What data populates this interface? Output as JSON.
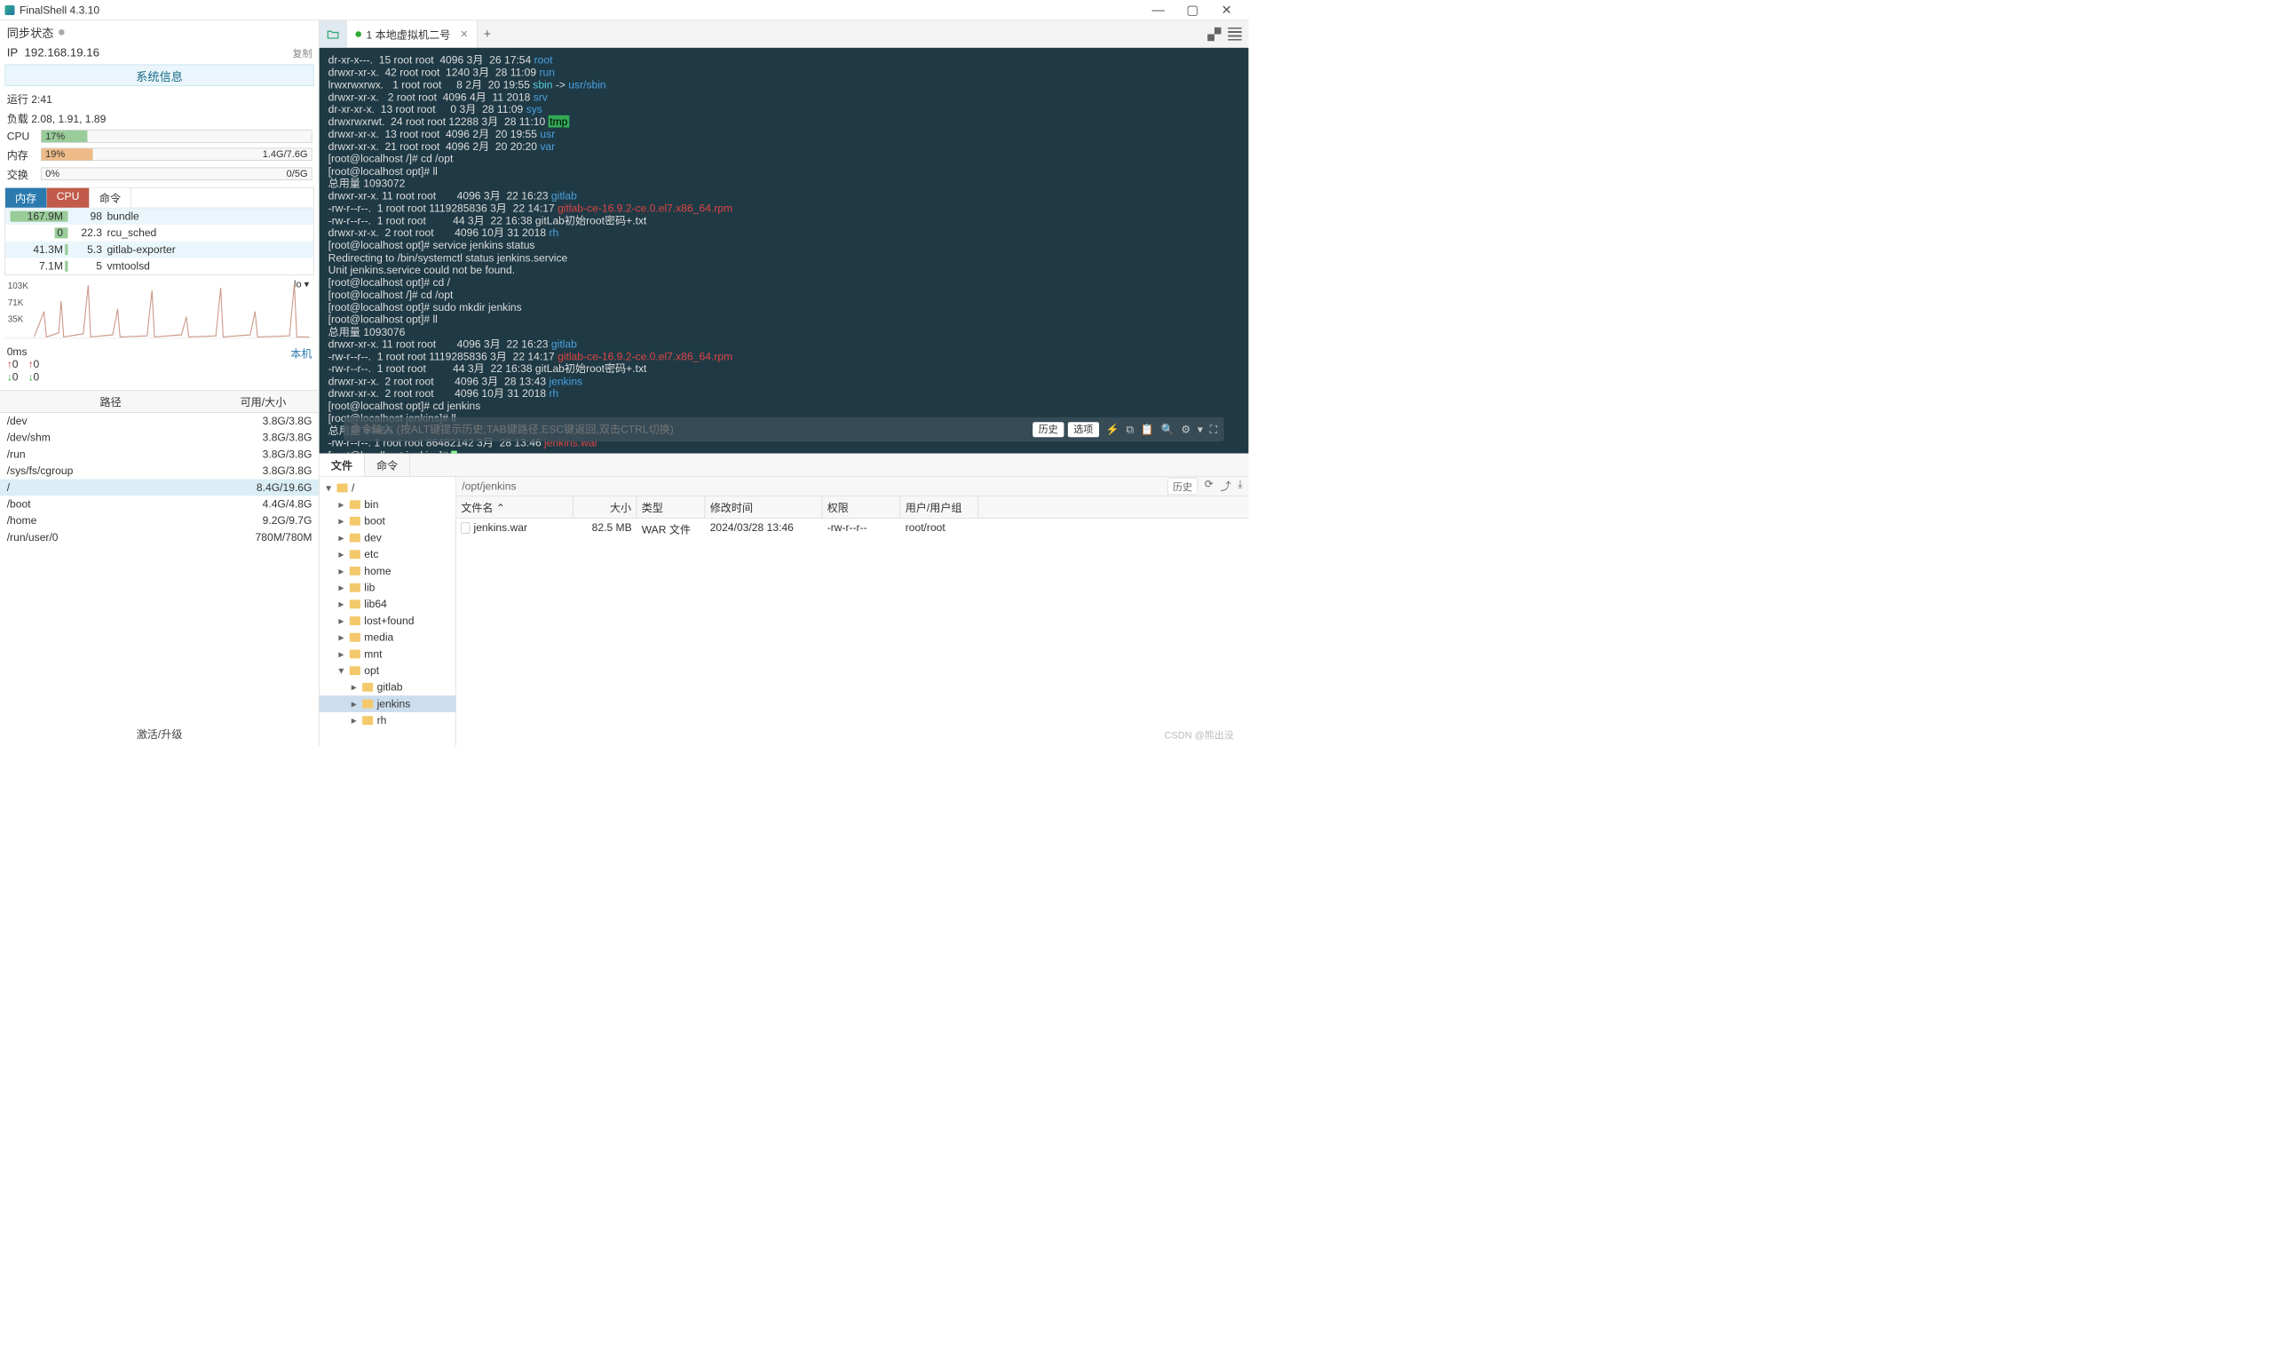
{
  "app": {
    "title": "FinalShell 4.3.10"
  },
  "window_buttons": {
    "min": "—",
    "max": "▢",
    "close": "✕"
  },
  "left": {
    "sync_label": "同步状态",
    "ip_label": "IP",
    "ip_value": "192.168.19.16",
    "copy_label": "复制",
    "sysinfo_btn": "系统信息",
    "uptime": "运行 2:41",
    "load": "负载 2.08, 1.91, 1.89",
    "cpu_label": "CPU",
    "cpu_pct": "17%",
    "mem_label": "内存",
    "mem_pct": "19%",
    "mem_text": "1.4G/7.6G",
    "swap_label": "交换",
    "swap_pct": "0%",
    "swap_text": "0/5G",
    "tabs": {
      "mem": "内存",
      "cpu": "CPU",
      "cmd": "命令"
    },
    "procs": [
      {
        "mem": "167.9M",
        "cpu": "98",
        "name": "bundle"
      },
      {
        "mem": "0",
        "cpu": "22.3",
        "name": "rcu_sched"
      },
      {
        "mem": "41.3M",
        "cpu": "5.3",
        "name": "gitlab-exporter"
      },
      {
        "mem": "7.1M",
        "cpu": "5",
        "name": "vmtoolsd"
      }
    ],
    "spark_y": [
      "103K",
      "71K",
      "35K"
    ],
    "spark_lo": "lo  ▾",
    "net": {
      "ms": "0ms",
      "local": "本机",
      "up1": "0",
      "dn1": "0",
      "up2": "0",
      "dn2": "0"
    },
    "fs_head": {
      "path": "路径",
      "size": "可用/大小"
    },
    "fs": [
      {
        "p": "/dev",
        "s": "3.8G/3.8G"
      },
      {
        "p": "/dev/shm",
        "s": "3.8G/3.8G"
      },
      {
        "p": "/run",
        "s": "3.8G/3.8G"
      },
      {
        "p": "/sys/fs/cgroup",
        "s": "3.8G/3.8G"
      },
      {
        "p": "/",
        "s": "8.4G/19.6G",
        "hl": true
      },
      {
        "p": "/boot",
        "s": "4.4G/4.8G"
      },
      {
        "p": "/home",
        "s": "9.2G/9.7G"
      },
      {
        "p": "/run/user/0",
        "s": "780M/780M"
      }
    ],
    "activate": "激活/升级"
  },
  "tabs_top": {
    "name": "1 本地虚拟机二号"
  },
  "terminal_lines": [
    {
      "segs": [
        {
          "t": "dr-xr-x---.  15 root root  4096 3月  26 17:54 "
        },
        {
          "t": "root",
          "c": "c-blue"
        }
      ]
    },
    {
      "segs": [
        {
          "t": "drwxr-xr-x.  42 root root  1240 3月  28 11:09 "
        },
        {
          "t": "run",
          "c": "c-blue"
        }
      ]
    },
    {
      "segs": [
        {
          "t": "lrwxrwxrwx.   1 root root     8 2月  20 19:55 "
        },
        {
          "t": "sbin",
          "c": "c-cyan"
        },
        {
          "t": " -> "
        },
        {
          "t": "usr/sbin",
          "c": "c-blue"
        }
      ]
    },
    {
      "segs": [
        {
          "t": "drwxr-xr-x.   2 root root  4096 4月  11 2018 "
        },
        {
          "t": "srv",
          "c": "c-blue"
        }
      ]
    },
    {
      "segs": [
        {
          "t": "dr-xr-xr-x.  13 root root     0 3月  28 11:09 "
        },
        {
          "t": "sys",
          "c": "c-blue"
        }
      ]
    },
    {
      "segs": [
        {
          "t": "drwxrwxrwt.  24 root root 12288 3月  28 11:10 "
        },
        {
          "t": "tmp",
          "c": "c-green"
        }
      ]
    },
    {
      "segs": [
        {
          "t": "drwxr-xr-x.  13 root root  4096 2月  20 19:55 "
        },
        {
          "t": "usr",
          "c": "c-blue"
        }
      ]
    },
    {
      "segs": [
        {
          "t": "drwxr-xr-x.  21 root root  4096 2月  20 20:20 "
        },
        {
          "t": "var",
          "c": "c-blue"
        }
      ]
    },
    {
      "segs": [
        {
          "t": "[root@localhost /]# cd /opt"
        }
      ]
    },
    {
      "segs": [
        {
          "t": "[root@localhost opt]# ll"
        }
      ]
    },
    {
      "segs": [
        {
          "t": "总用量 1093072"
        }
      ]
    },
    {
      "segs": [
        {
          "t": "drwxr-xr-x. 11 root root       4096 3月  22 16:23 "
        },
        {
          "t": "gitlab",
          "c": "c-blue"
        }
      ]
    },
    {
      "segs": [
        {
          "t": "-rw-r--r--.  1 root root 1119285836 3月  22 14:17 "
        },
        {
          "t": "gitlab-ce-16.9.2-ce.0.el7.x86_64.rpm",
          "c": "c-red"
        }
      ]
    },
    {
      "segs": [
        {
          "t": "-rw-r--r--.  1 root root         44 3月  22 16:38 gitLab初始root密码+.txt"
        }
      ]
    },
    {
      "segs": [
        {
          "t": "drwxr-xr-x.  2 root root       4096 10月 31 2018 "
        },
        {
          "t": "rh",
          "c": "c-blue"
        }
      ]
    },
    {
      "segs": [
        {
          "t": "[root@localhost opt]# service jenkins status"
        }
      ]
    },
    {
      "segs": [
        {
          "t": "Redirecting to /bin/systemctl status jenkins.service"
        }
      ]
    },
    {
      "segs": [
        {
          "t": "Unit jenkins.service could not be found."
        }
      ]
    },
    {
      "segs": [
        {
          "t": "[root@localhost opt]# cd /"
        }
      ]
    },
    {
      "segs": [
        {
          "t": "[root@localhost /]# cd /opt"
        }
      ]
    },
    {
      "segs": [
        {
          "t": "[root@localhost opt]# sudo mkdir jenkins"
        }
      ]
    },
    {
      "segs": [
        {
          "t": "[root@localhost opt]# ll"
        }
      ]
    },
    {
      "segs": [
        {
          "t": "总用量 1093076"
        }
      ]
    },
    {
      "segs": [
        {
          "t": "drwxr-xr-x. 11 root root       4096 3月  22 16:23 "
        },
        {
          "t": "gitlab",
          "c": "c-blue"
        }
      ]
    },
    {
      "segs": [
        {
          "t": "-rw-r--r--.  1 root root 1119285836 3月  22 14:17 "
        },
        {
          "t": "gitlab-ce-16.9.2-ce.0.el7.x86_64.rpm",
          "c": "c-red"
        }
      ]
    },
    {
      "segs": [
        {
          "t": "-rw-r--r--.  1 root root         44 3月  22 16:38 gitLab初始root密码+.txt"
        }
      ]
    },
    {
      "segs": [
        {
          "t": "drwxr-xr-x.  2 root root       4096 3月  28 13:43 "
        },
        {
          "t": "jenkins",
          "c": "c-blue"
        }
      ]
    },
    {
      "segs": [
        {
          "t": "drwxr-xr-x.  2 root root       4096 10月 31 2018 "
        },
        {
          "t": "rh",
          "c": "c-blue"
        }
      ]
    },
    {
      "segs": [
        {
          "t": "[root@localhost opt]# cd jenkins"
        }
      ]
    },
    {
      "segs": [
        {
          "t": "[root@localhost jenkins]# ll"
        }
      ]
    },
    {
      "segs": [
        {
          "t": "总用量 84456"
        }
      ]
    },
    {
      "segs": [
        {
          "t": "-rw-r--r--. 1 root root 86482142 3月  28 13:46 "
        },
        {
          "t": "jenkins.war",
          "c": "c-red"
        }
      ]
    },
    {
      "segs": [
        {
          "t": "[root@localhost jenkins]# "
        },
        {
          "t": "",
          "cursor": true
        }
      ]
    }
  ],
  "cmd_input": {
    "placeholder": "命令输入 (按ALT键提示历史,TAB键路径,ESC键返回,双击CTRL切换)",
    "history": "历史",
    "options": "选项"
  },
  "filetabs": {
    "file": "文件",
    "cmd": "命令"
  },
  "pathbar": {
    "path": "/opt/jenkins",
    "history": "历史"
  },
  "tree": [
    {
      "lvl": 0,
      "name": "/",
      "open": true
    },
    {
      "lvl": 1,
      "name": "bin"
    },
    {
      "lvl": 1,
      "name": "boot"
    },
    {
      "lvl": 1,
      "name": "dev"
    },
    {
      "lvl": 1,
      "name": "etc"
    },
    {
      "lvl": 1,
      "name": "home"
    },
    {
      "lvl": 1,
      "name": "lib"
    },
    {
      "lvl": 1,
      "name": "lib64"
    },
    {
      "lvl": 1,
      "name": "lost+found"
    },
    {
      "lvl": 1,
      "name": "media"
    },
    {
      "lvl": 1,
      "name": "mnt"
    },
    {
      "lvl": 1,
      "name": "opt",
      "open": true
    },
    {
      "lvl": 2,
      "name": "gitlab"
    },
    {
      "lvl": 2,
      "name": "jenkins",
      "sel": true
    },
    {
      "lvl": 2,
      "name": "rh"
    }
  ],
  "list_head": {
    "name": "文件名 ⌃",
    "size": "大小",
    "type": "类型",
    "date": "修改时间",
    "perm": "权限",
    "own": "用户/用户组"
  },
  "list_rows": [
    {
      "name": "jenkins.war",
      "size": "82.5 MB",
      "type": "WAR 文件",
      "date": "2024/03/28 13:46",
      "perm": "-rw-r--r--",
      "own": "root/root"
    }
  ],
  "watermark": "CSDN @熊出没"
}
